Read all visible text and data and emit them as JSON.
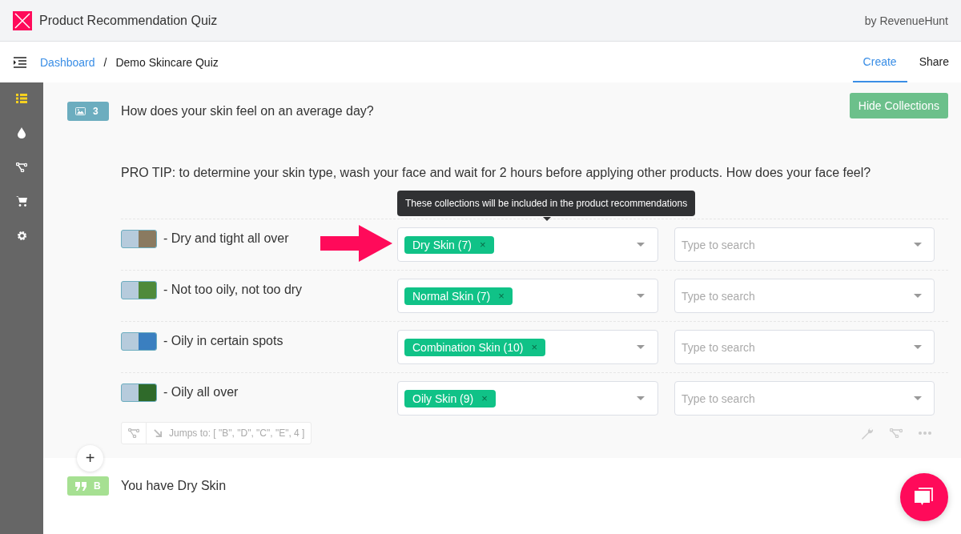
{
  "header": {
    "title": "Product Recommendation Quiz",
    "byline": "by RevenueHunt"
  },
  "breadcrumb": {
    "link": "Dashboard",
    "separator": "/",
    "current": "Demo Skincare Quiz"
  },
  "tabs": [
    {
      "label": "Create",
      "selected": true
    },
    {
      "label": "Share",
      "selected": false
    }
  ],
  "sidebar": {
    "items": [
      {
        "kind": "list",
        "selected": true
      },
      {
        "kind": "drop",
        "selected": false
      },
      {
        "kind": "flow",
        "selected": false
      },
      {
        "kind": "cart",
        "selected": false
      },
      {
        "kind": "gear",
        "selected": false
      }
    ]
  },
  "question": {
    "badge": "3",
    "text": "How does your skin feel on an average day?",
    "tip": "PRO TIP: to determine your skin type, wash your face and wait for 2 hours before applying other products. How does your face feel?",
    "hide_button": "Hide Collections",
    "tooltip": "These collections will be included in the product recommendations",
    "answers": [
      {
        "label": "- Dry and tight all over",
        "color": "#8a7a60",
        "tag": "Dry Skin (7)",
        "remove": "×",
        "placeholder": "Type to search"
      },
      {
        "label": "- Not too oily, not too dry",
        "color": "#4f8a3a",
        "tag": "Normal Skin (7)",
        "remove": "×",
        "placeholder": "Type to search"
      },
      {
        "label": "- Oily in certain spots",
        "color": "#3a7fc0",
        "tag": "Combination Skin (10)",
        "remove": "×",
        "placeholder": "Type to search"
      },
      {
        "label": "- Oily all over",
        "color": "#2f6a2a",
        "tag": "Oily Skin (9)",
        "remove": "×",
        "placeholder": "Type to search"
      }
    ],
    "jumps": "Jumps to: [ \"B\", \"D\", \"C\", \"E\", 4 ]"
  },
  "add_button": "+",
  "result": {
    "badge": "B",
    "text": "You have Dry Skin"
  }
}
